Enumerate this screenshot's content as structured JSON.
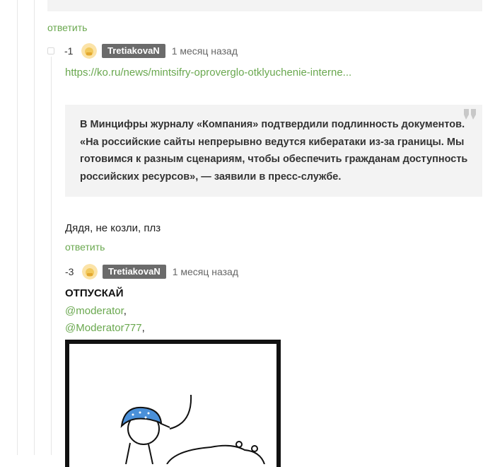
{
  "comments": [
    {
      "reply_label": "ответить"
    },
    {
      "rating": "-1",
      "author": "TretiakovaN",
      "time": "1 месяц назад",
      "link": "https://ko.ru/news/mintsifry-oproverglo-otklyuchenie-interne...",
      "quote": "В Минцифры журналу «Компания» подтвердили подлинность документов. «На российские сайты непрерывно ведутся кибератаки из-за границы. Мы готовимся к разным сценариям, чтобы обеспечить гражданам доступность российских ресурсов», — заявили в пресс-службе.",
      "body": "Дядя, не козли, плз",
      "reply_label": "ответить"
    },
    {
      "rating": "-3",
      "author": "TretiakovaN",
      "time": "1 месяц назад",
      "title": "ОТПУСКАЙ",
      "mentions": [
        "@moderator",
        "@Moderator777"
      ],
      "mention_sep": ","
    }
  ],
  "colors": {
    "link": "#6aa84f",
    "badge": "#6b6b6b",
    "quote_bg": "#f3f3f3",
    "cap": "#4a90d9"
  },
  "icons": {
    "avatar": "avatar-icon",
    "collapse": "collapse-icon",
    "quote": "quote-mark-icon"
  }
}
